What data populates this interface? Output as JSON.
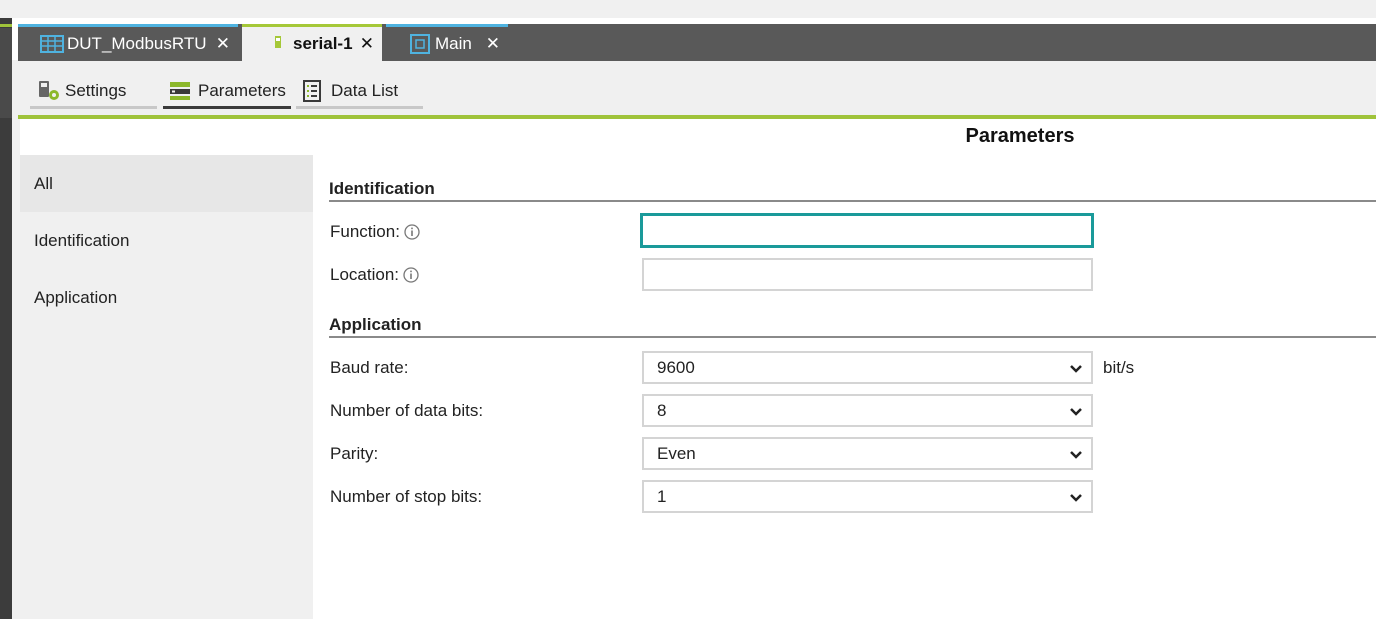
{
  "doc_tabs": [
    {
      "label": "DUT_ModbusRTU",
      "icon": "table-icon",
      "close": "✕"
    },
    {
      "label": "serial-1",
      "icon": "device-icon",
      "close": "✕"
    },
    {
      "label": "Main",
      "icon": "window-icon",
      "close": "✕"
    }
  ],
  "sub_tabs": [
    {
      "label": "Settings",
      "icon": "settings-device-icon"
    },
    {
      "label": "Parameters",
      "icon": "parameters-icon",
      "active": true
    },
    {
      "label": "Data List",
      "icon": "list-icon"
    }
  ],
  "page_title": "Parameters",
  "nav": [
    {
      "label": "All",
      "selected": true
    },
    {
      "label": "Identification"
    },
    {
      "label": "Application"
    }
  ],
  "sections": {
    "identification": {
      "title": "Identification",
      "function_label": "Function:",
      "function_value": "",
      "location_label": "Location:",
      "location_value": ""
    },
    "application": {
      "title": "Application",
      "baud_label": "Baud rate:",
      "baud_value": "9600",
      "baud_unit": "bit/s",
      "databits_label": "Number of data bits:",
      "databits_value": "8",
      "parity_label": "Parity:",
      "parity_value": "Even",
      "stopbits_label": "Number of stop bits:",
      "stopbits_value": "1"
    }
  },
  "colors": {
    "accent_green": "#9fc33a",
    "tab_blue": "#4fb3e0",
    "focus_teal": "#1a9a9a",
    "tabbar_bg": "#595959"
  }
}
